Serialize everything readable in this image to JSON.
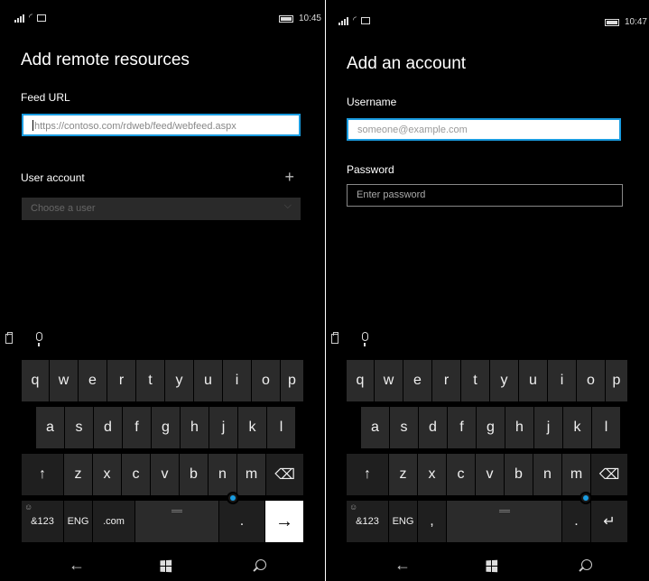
{
  "left_screen": {
    "status": {
      "time": "10:45"
    },
    "title": "Add remote resources",
    "feed_url": {
      "label": "Feed URL",
      "placeholder": "https://contoso.com/rdweb/feed/webfeed.aspx"
    },
    "user_account": {
      "label": "User account",
      "add_symbol": "+",
      "dropdown_placeholder": "Choose a user"
    },
    "keyboard": {
      "row1": [
        "q",
        "w",
        "e",
        "r",
        "t",
        "y",
        "u",
        "i",
        "o",
        "p"
      ],
      "row2": [
        "a",
        "s",
        "d",
        "f",
        "g",
        "h",
        "j",
        "k",
        "l"
      ],
      "row3": [
        "↑",
        "z",
        "x",
        "c",
        "v",
        "b",
        "n",
        "m",
        "⌫"
      ],
      "row4": [
        "&123",
        "ENG",
        ".com",
        "",
        "",
        "→"
      ],
      "period": "."
    }
  },
  "right_screen": {
    "status": {
      "time": "10:47"
    },
    "title": "Add an account",
    "username": {
      "label": "Username",
      "placeholder": "someone@example.com"
    },
    "password": {
      "label": "Password",
      "placeholder": "Enter password"
    },
    "keyboard": {
      "row1": [
        "q",
        "w",
        "e",
        "r",
        "t",
        "y",
        "u",
        "i",
        "o",
        "p"
      ],
      "row2": [
        "a",
        "s",
        "d",
        "f",
        "g",
        "h",
        "j",
        "k",
        "l"
      ],
      "row3": [
        "↑",
        "z",
        "x",
        "c",
        "v",
        "b",
        "n",
        "m",
        "⌫"
      ],
      "row4": [
        "&123",
        "ENG",
        ",",
        "",
        "",
        "↵"
      ],
      "period": "."
    }
  },
  "icons": {
    "back": "←",
    "dropdown_chevron": "⌵",
    "emoji": "☺",
    "wifi": "◜"
  },
  "colors": {
    "accent": "#1a9ce0",
    "background": "#000000",
    "key": "#2b2b2b",
    "key_function": "#1f1f1f"
  }
}
